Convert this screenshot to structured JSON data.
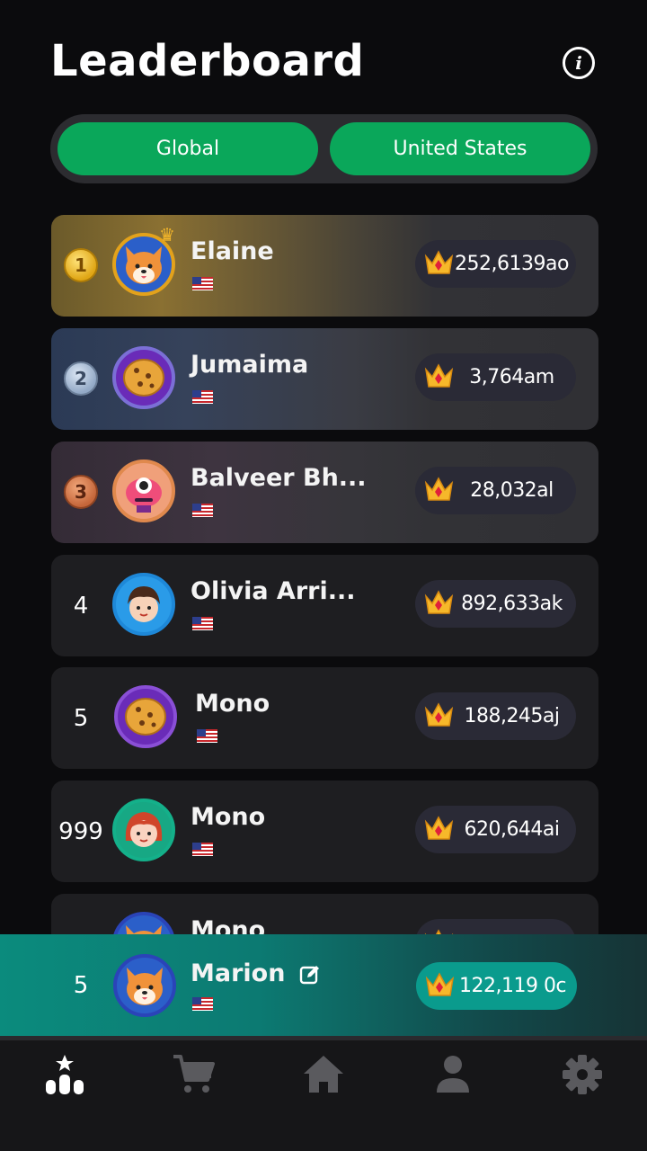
{
  "header": {
    "title": "Leaderboard"
  },
  "tabs_segment": {
    "global": "Global",
    "country": "United States"
  },
  "rows": [
    {
      "rank": "1",
      "name": "Elaine",
      "score": "252,6139ao",
      "avatar": "fox-avatar"
    },
    {
      "rank": "2",
      "name": "Jumaima",
      "score": "3,764am",
      "avatar": "cookie-avatar"
    },
    {
      "rank": "3",
      "name": "Balveer Bh...",
      "score": "28,032al",
      "avatar": "alien-avatar"
    },
    {
      "rank": "4",
      "name": "Olivia Arri...",
      "score": "892,633ak",
      "avatar": "boy-avatar"
    },
    {
      "rank": "5",
      "name": "Mono",
      "score": "188,245aj",
      "avatar": "cookie-avatar"
    },
    {
      "rank": "999",
      "name": "Mono",
      "score": "620,644ai",
      "avatar": "girl-avatar"
    },
    {
      "rank": "",
      "name": "Mono",
      "score": "",
      "avatar": "fox-avatar"
    }
  ],
  "me": {
    "rank": "5",
    "name": "Marion",
    "score": "122,119 0c"
  },
  "colors": {
    "accent": "#0aa75a",
    "gold": "#e3a21b",
    "background": "#0b0b0d"
  }
}
